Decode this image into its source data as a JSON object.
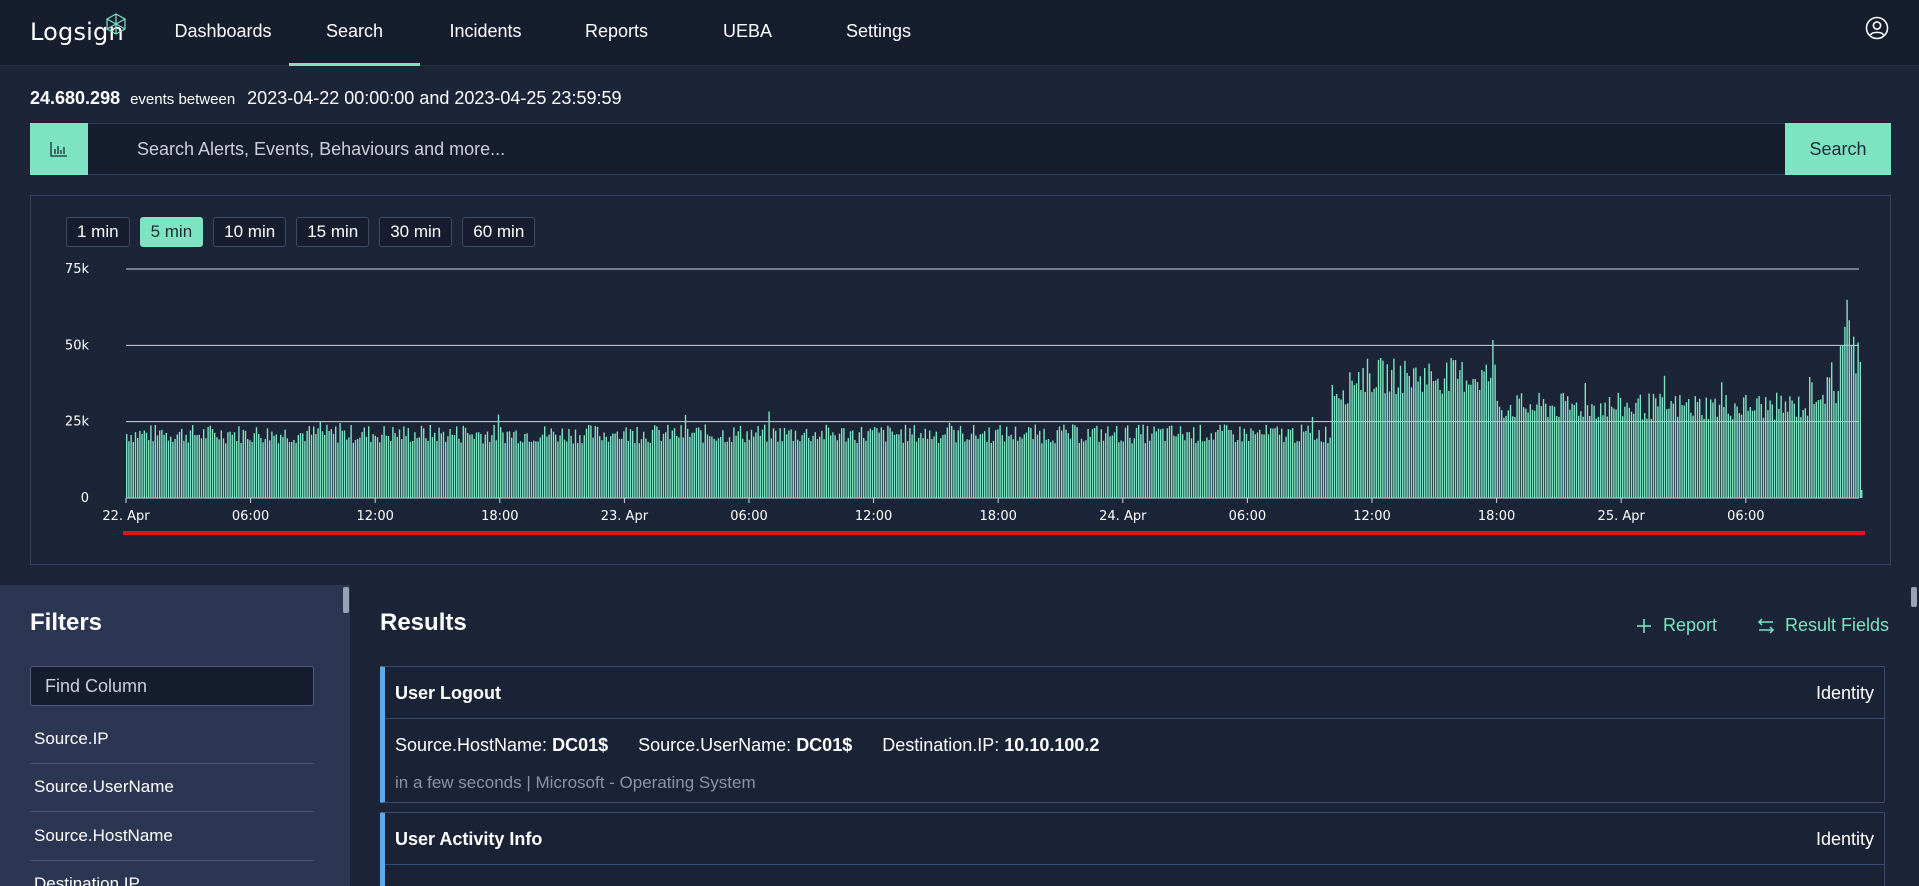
{
  "brand": {
    "name": "Logsign"
  },
  "nav": {
    "items": [
      {
        "label": "Dashboards"
      },
      {
        "label": "Search"
      },
      {
        "label": "Incidents"
      },
      {
        "label": "Reports"
      },
      {
        "label": "UEBA"
      },
      {
        "label": "Settings"
      }
    ],
    "active": "Search"
  },
  "summary": {
    "count": "24.680.298",
    "between_label": "events between",
    "range": "2023-04-22 00:00:00 and 2023-04-25 23:59:59"
  },
  "search": {
    "placeholder": "Search Alerts, Events, Behaviours and more...",
    "button_label": "Search"
  },
  "intervals": {
    "options": [
      "1 min",
      "5 min",
      "10 min",
      "15 min",
      "30 min",
      "60 min"
    ],
    "selected": "5 min"
  },
  "colors": {
    "accent": "#7de3c1",
    "bar": "#7de3c1",
    "range_line": "#e0141e",
    "card_border": "#5fa9e6"
  },
  "chart_data": {
    "type": "bar",
    "ylim": [
      0,
      75000
    ],
    "y_ticks": [
      "0",
      "25k",
      "50k",
      "75k"
    ],
    "x_ticks": [
      "22. Apr",
      "06:00",
      "12:00",
      "18:00",
      "23. Apr",
      "06:00",
      "12:00",
      "18:00",
      "24. Apr",
      "06:00",
      "12:00",
      "18:00",
      "25. Apr",
      "06:00"
    ],
    "x_start": "2023-04-22 00:00",
    "x_end": "2023-04-25 23:59",
    "grid": true,
    "series": [
      {
        "segments": [
          {
            "from": "2023-04-22 00:00",
            "to": "2023-04-24 10:00",
            "value": 21000
          },
          {
            "from": "2023-04-24 10:00",
            "to": "2023-04-24 11:00",
            "value": 36000
          },
          {
            "from": "2023-04-24 11:00",
            "to": "2023-04-24 18:00",
            "value": 40000
          },
          {
            "from": "2023-04-24 18:00",
            "to": "2023-04-25 09:00",
            "value": 30000
          },
          {
            "from": "2023-04-25 09:00",
            "to": "2023-04-25 10:30",
            "value": 35000
          },
          {
            "from": "2023-04-25 10:30",
            "to": "2023-04-25 11:00",
            "value": 53000
          },
          {
            "from": "2023-04-25 11:00",
            "to": "2023-04-25 11:30",
            "value": 48000
          }
        ]
      }
    ]
  },
  "filters": {
    "title": "Filters",
    "find_placeholder": "Find Column",
    "items": [
      "Source.IP",
      "Source.UserName",
      "Source.HostName",
      "Destination.IP"
    ]
  },
  "results": {
    "title": "Results",
    "report_label": "Report",
    "fields_label": "Result Fields",
    "cards": [
      {
        "title": "User Logout",
        "category": "Identity",
        "fields": [
          {
            "key": "Source.HostName:",
            "value": "DC01$"
          },
          {
            "key": "Source.UserName:",
            "value": "DC01$"
          },
          {
            "key": "Destination.IP:",
            "value": "10.10.100.2"
          }
        ],
        "meta": "in a few seconds | Microsoft - Operating System"
      },
      {
        "title": "User Activity Info",
        "category": "Identity"
      }
    ]
  }
}
